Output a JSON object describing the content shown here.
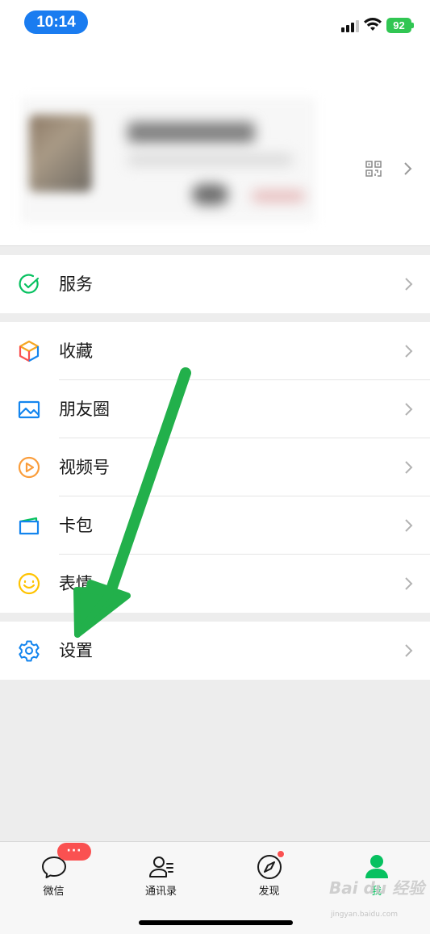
{
  "status_bar": {
    "time": "10:14",
    "battery": "92"
  },
  "profile": {
    "qr_icon": "qr-code-icon",
    "chevron_icon": "chevron-right-icon"
  },
  "groups": [
    {
      "items": [
        {
          "label": "服务",
          "icon": "service-check-icon",
          "color": "#07c160"
        }
      ]
    },
    {
      "items": [
        {
          "label": "收藏",
          "icon": "favorites-cube-icon",
          "color": "#f5a623"
        },
        {
          "label": "朋友圈",
          "icon": "moments-image-icon",
          "color": "#1485ee"
        },
        {
          "label": "视频号",
          "icon": "channels-play-icon",
          "color": "#fa9d3b"
        },
        {
          "label": "卡包",
          "icon": "card-wallet-icon",
          "color": "#1485ee"
        },
        {
          "label": "表情",
          "icon": "sticker-smile-icon",
          "color": "#ffc300"
        }
      ]
    },
    {
      "items": [
        {
          "label": "设置",
          "icon": "gear-icon",
          "color": "#1485ee"
        }
      ]
    }
  ],
  "tabbar": {
    "tabs": [
      {
        "label": "微信",
        "icon": "chat-bubble-icon",
        "badge": "···"
      },
      {
        "label": "通讯录",
        "icon": "contacts-icon"
      },
      {
        "label": "发现",
        "icon": "compass-icon"
      },
      {
        "label": "我",
        "icon": "me-person-icon",
        "active": true
      }
    ],
    "active_color": "#07c160"
  },
  "annotation": {
    "arrow_color": "#22b04b"
  },
  "watermark": {
    "main": "Bai du 经验",
    "sub": "jingyan.baidu.com"
  }
}
